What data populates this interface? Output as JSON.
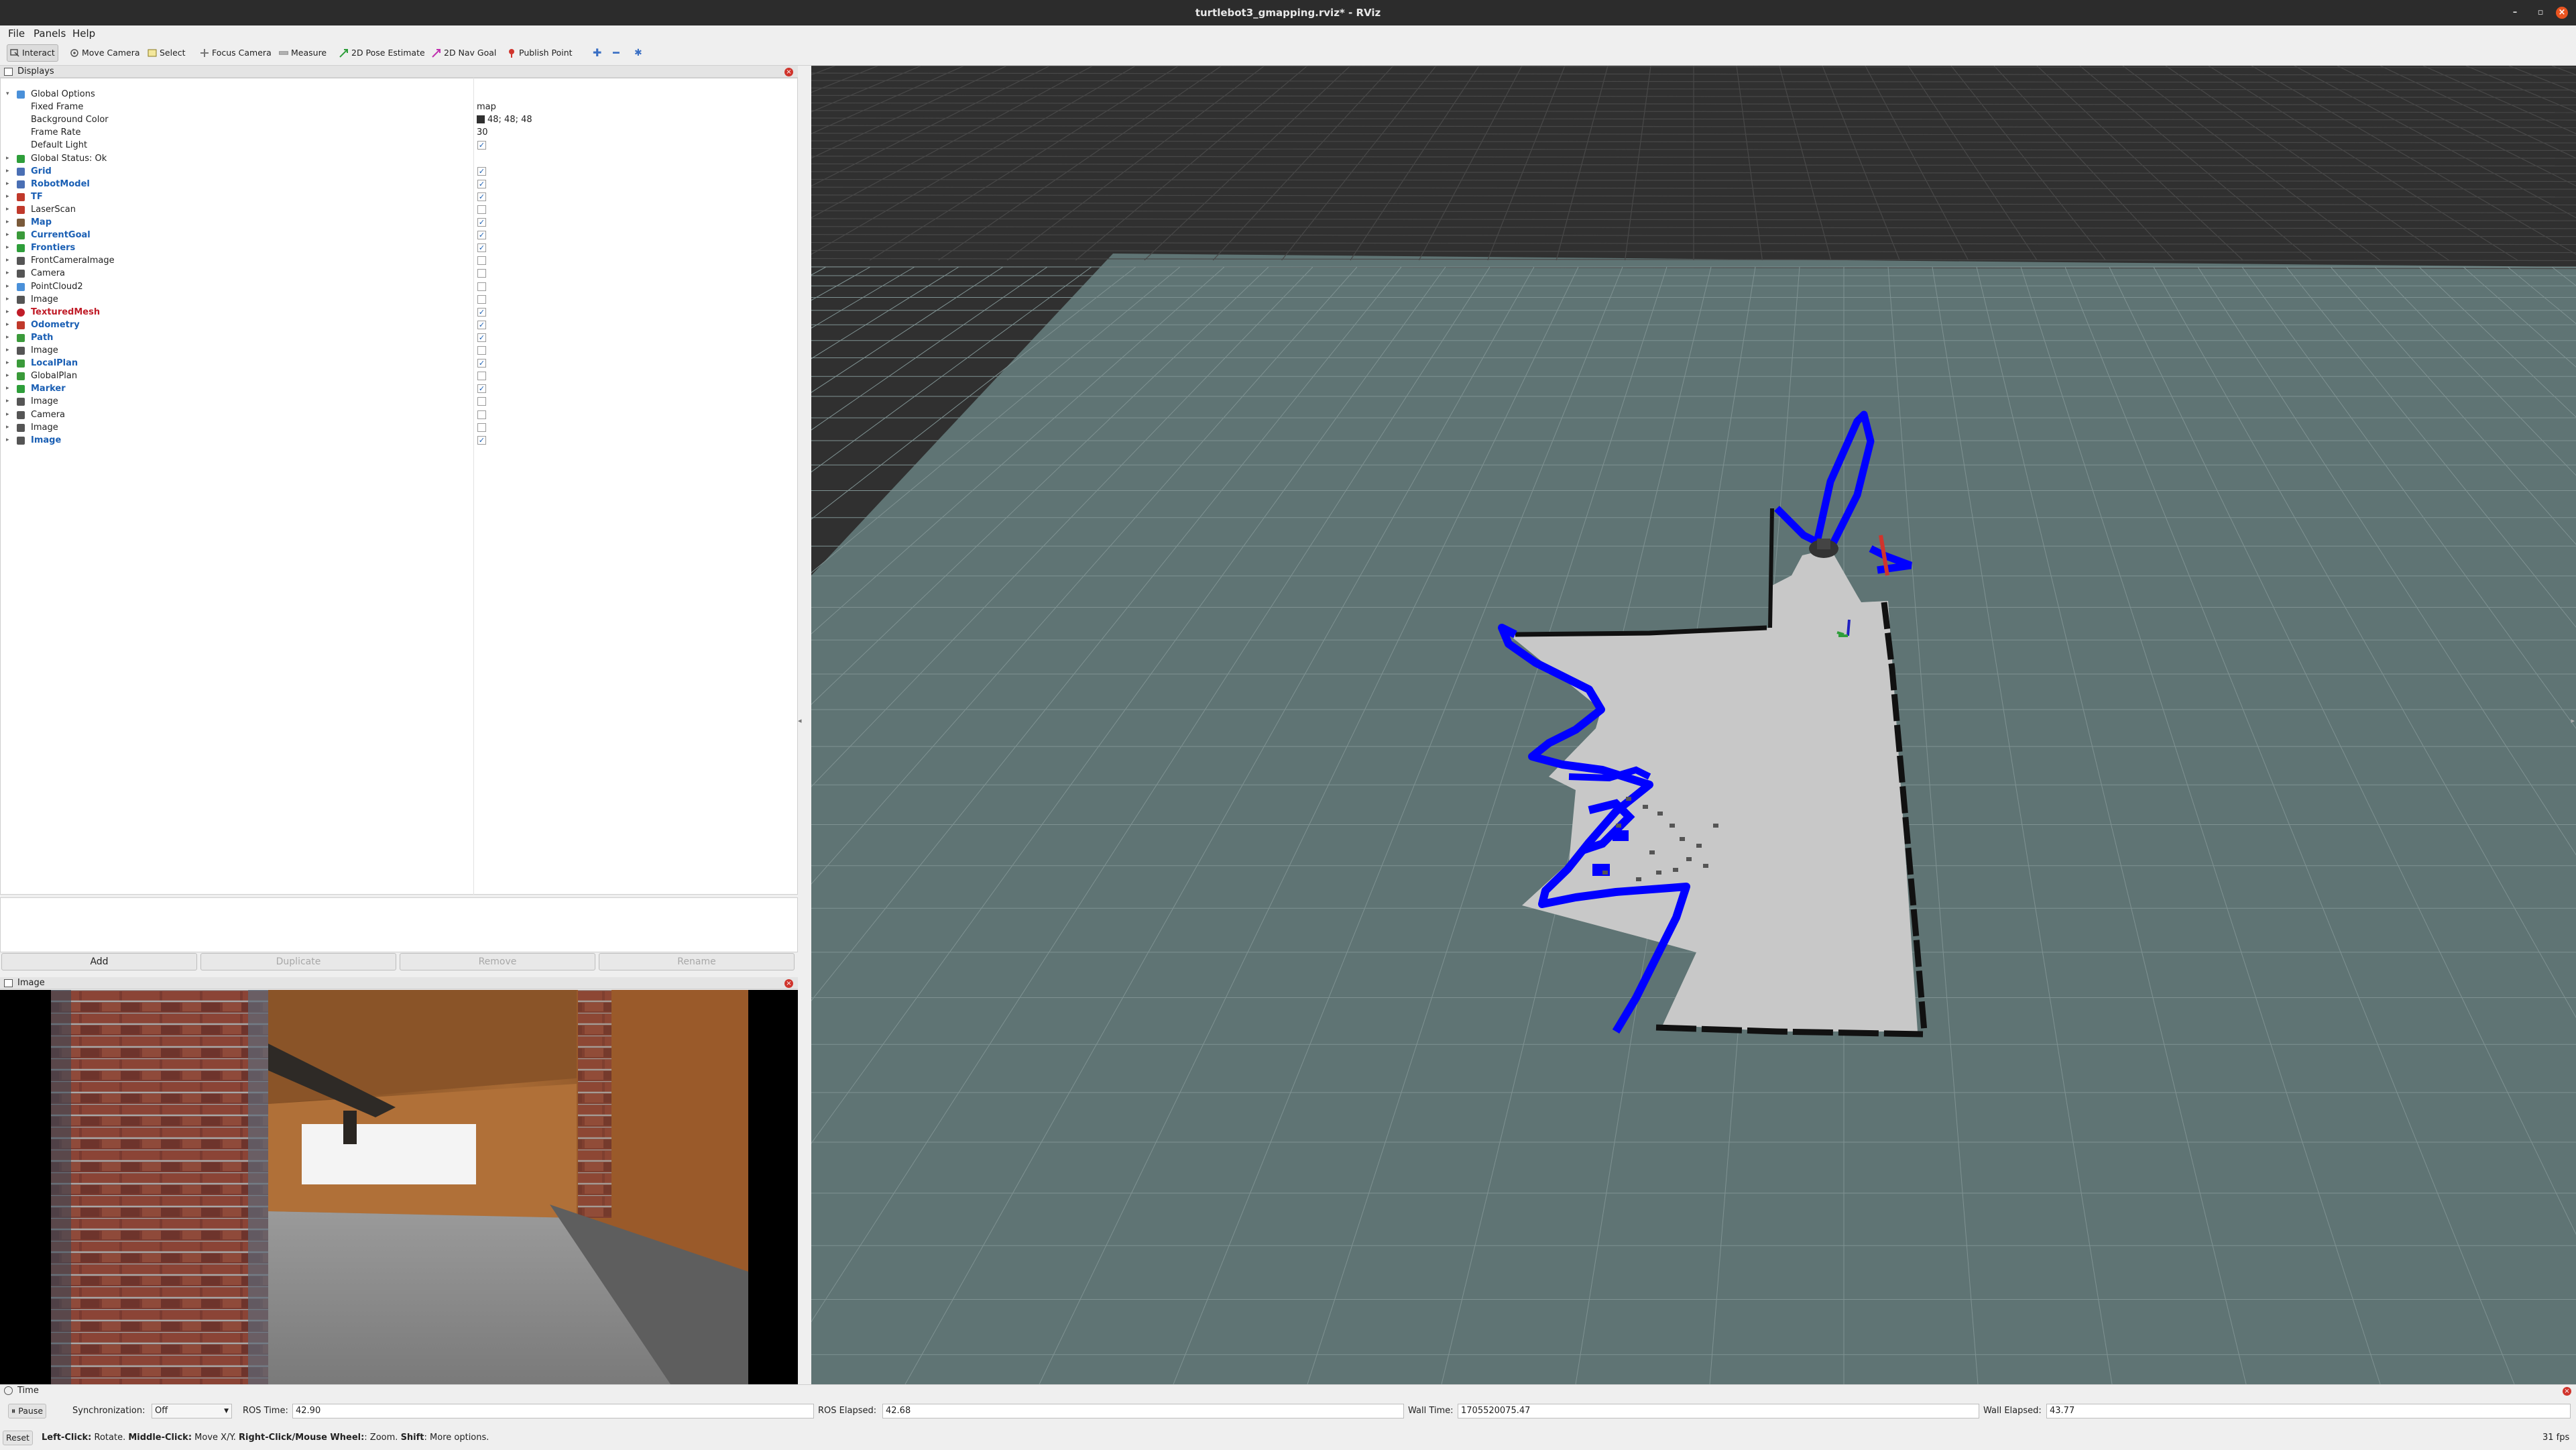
{
  "window": {
    "title": "turtlebot3_gmapping.rviz* - RViz"
  },
  "menu": [
    {
      "label": "File"
    },
    {
      "label": "Panels"
    },
    {
      "label": "Help"
    }
  ],
  "toolbar": {
    "interact": "Interact",
    "move_camera": "Move Camera",
    "select": "Select",
    "focus_camera": "Focus Camera",
    "measure": "Measure",
    "pose_estimate": "2D Pose Estimate",
    "nav_goal": "2D Nav Goal",
    "publish_point": "Publish Point"
  },
  "displays": {
    "title": "Displays",
    "rows": [
      {
        "name": "Global Options",
        "value": "",
        "style": "normal",
        "icon": "gear-icon",
        "color": "#4a90d9",
        "expand": "open",
        "check": null
      },
      {
        "name": "Fixed Frame",
        "value": "map",
        "style": "child",
        "icon": "",
        "color": "",
        "expand": "",
        "check": null
      },
      {
        "name": "Background Color",
        "value": "48; 48; 48",
        "style": "child",
        "icon": "",
        "color": "",
        "expand": "",
        "check": null,
        "swatch": true
      },
      {
        "name": "Frame Rate",
        "value": "30",
        "style": "child",
        "icon": "",
        "color": "",
        "expand": "",
        "check": null
      },
      {
        "name": "Default Light",
        "value": "",
        "style": "child",
        "icon": "",
        "color": "",
        "expand": "",
        "check": true
      },
      {
        "name": "Global Status: Ok",
        "value": "",
        "style": "normal",
        "icon": "checkmark-icon",
        "color": "#2e9e3a",
        "expand": "closed",
        "check": null
      },
      {
        "name": "Grid",
        "value": "",
        "style": "blue",
        "icon": "grid-icon",
        "color": "#4a6fb4",
        "expand": "closed",
        "check": true
      },
      {
        "name": "RobotModel",
        "value": "",
        "style": "blue",
        "icon": "robot-icon",
        "color": "#4a6fb4",
        "expand": "closed",
        "check": true
      },
      {
        "name": "TF",
        "value": "",
        "style": "blue",
        "icon": "axes-icon",
        "color": "#c0392b",
        "expand": "closed",
        "check": true
      },
      {
        "name": "LaserScan",
        "value": "",
        "style": "normal",
        "icon": "laser-icon",
        "color": "#c0392b",
        "expand": "closed",
        "check": false
      },
      {
        "name": "Map",
        "value": "",
        "style": "blue",
        "icon": "map-icon",
        "color": "#7a5a3a",
        "expand": "closed",
        "check": true
      },
      {
        "name": "CurrentGoal",
        "value": "",
        "style": "blue",
        "icon": "arrow-icon",
        "color": "#3a9a3a",
        "expand": "closed",
        "check": true
      },
      {
        "name": "Frontiers",
        "value": "",
        "style": "blue",
        "icon": "markers-icon",
        "color": "#2e9e3a",
        "expand": "closed",
        "check": true
      },
      {
        "name": "FrontCameraImage",
        "value": "",
        "style": "normal",
        "icon": "image-icon",
        "color": "#555555",
        "expand": "closed",
        "check": false
      },
      {
        "name": "Camera",
        "value": "",
        "style": "normal",
        "icon": "camera-icon",
        "color": "#555555",
        "expand": "closed",
        "check": false
      },
      {
        "name": "PointCloud2",
        "value": "",
        "style": "normal",
        "icon": "pointcloud-icon",
        "color": "#4a90d9",
        "expand": "closed",
        "check": false
      },
      {
        "name": "Image",
        "value": "",
        "style": "normal",
        "icon": "image-icon",
        "color": "#555555",
        "expand": "closed",
        "check": false
      },
      {
        "name": "TexturedMesh",
        "value": "",
        "style": "red",
        "icon": "error-icon",
        "color": "#c01c28",
        "expand": "closed",
        "check": true
      },
      {
        "name": "Odometry",
        "value": "",
        "style": "blue",
        "icon": "odometry-icon",
        "color": "#c0392b",
        "expand": "closed",
        "check": true
      },
      {
        "name": "Path",
        "value": "",
        "style": "blue",
        "icon": "path-icon",
        "color": "#3a9a3a",
        "expand": "closed",
        "check": true
      },
      {
        "name": "Image",
        "value": "",
        "style": "normal",
        "icon": "image-icon",
        "color": "#555555",
        "expand": "closed",
        "check": false
      },
      {
        "name": "LocalPlan",
        "value": "",
        "style": "blue",
        "icon": "path-icon",
        "color": "#3a9a3a",
        "expand": "closed",
        "check": true
      },
      {
        "name": "GlobalPlan",
        "value": "",
        "style": "normal",
        "icon": "path-icon",
        "color": "#3a9a3a",
        "expand": "closed",
        "check": false
      },
      {
        "name": "Marker",
        "value": "",
        "style": "blue",
        "icon": "marker-icon",
        "color": "#2e9e3a",
        "expand": "closed",
        "check": true
      },
      {
        "name": "Image",
        "value": "",
        "style": "normal",
        "icon": "image-icon",
        "color": "#555555",
        "expand": "closed",
        "check": false
      },
      {
        "name": "Camera",
        "value": "",
        "style": "normal",
        "icon": "camera-icon",
        "color": "#555555",
        "expand": "closed",
        "check": false
      },
      {
        "name": "Image",
        "value": "",
        "style": "normal",
        "icon": "image-icon",
        "color": "#555555",
        "expand": "closed",
        "check": false
      },
      {
        "name": "Image",
        "value": "",
        "style": "blue",
        "icon": "image-icon",
        "color": "#555555",
        "expand": "closed",
        "check": true
      }
    ],
    "buttons": {
      "add": "Add",
      "duplicate": "Duplicate",
      "remove": "Remove",
      "rename": "Rename"
    }
  },
  "image_panel": {
    "title": "Image"
  },
  "time_panel": {
    "title": "Time",
    "pause": "Pause",
    "sync_label": "Synchronization:",
    "sync_value": "Off",
    "ros_time_label": "ROS Time:",
    "ros_time": "42.90",
    "ros_elapsed_label": "ROS Elapsed:",
    "ros_elapsed": "42.68",
    "wall_time_label": "Wall Time:",
    "wall_time": "1705520075.47",
    "wall_elapsed_label": "Wall Elapsed:",
    "wall_elapsed": "43.77"
  },
  "statusbar": {
    "reset": "Reset",
    "hint_left_key": "Left-Click:",
    "hint_left": " Rotate. ",
    "hint_middle_key": "Middle-Click:",
    "hint_middle": " Move X/Y. ",
    "hint_right_key": "Right-Click/Mouse Wheel:",
    "hint_right": ": Zoom. ",
    "hint_shift_key": "Shift",
    "hint_shift": ": More options.",
    "fps": "31 fps"
  },
  "colors": {
    "background": "#303030",
    "plane": "#5f7474",
    "map_free": "#c8c8c8",
    "frontier": "#0000ff"
  }
}
